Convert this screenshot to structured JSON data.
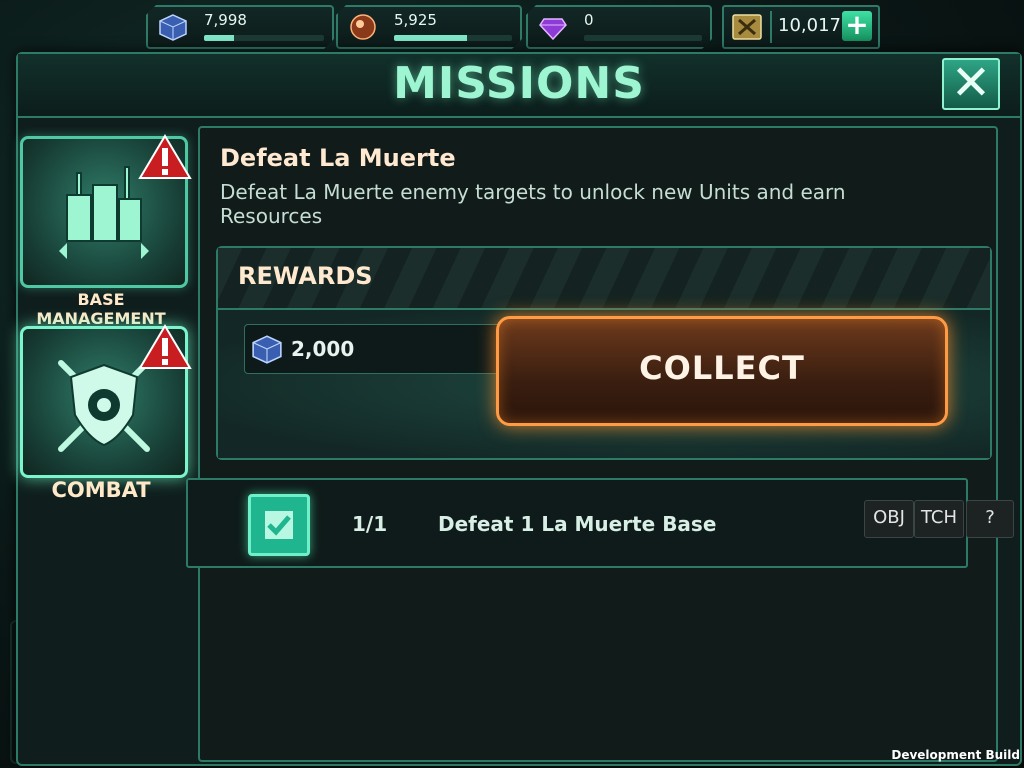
{
  "resources": {
    "cubes": {
      "icon": "cube-icon",
      "value": "7,998",
      "fill": 0.25
    },
    "ore": {
      "icon": "ore-icon",
      "value": "5,925",
      "fill": 0.62
    },
    "gems": {
      "icon": "gem-icon",
      "value": "0",
      "fill": 0.0
    },
    "gold": {
      "icon": "gold-icon",
      "value": "10,017"
    }
  },
  "header": {
    "title": "MISSIONS",
    "close_icon": "close-icon"
  },
  "sidebar": {
    "items": [
      {
        "label": "BASE MANAGEMENT",
        "icon": "base-icon",
        "alert": true,
        "active": false
      },
      {
        "label": "COMBAT",
        "icon": "combat-icon",
        "alert": true,
        "active": true
      }
    ]
  },
  "mission": {
    "title": "Defeat La Muerte",
    "description": "Defeat La Muerte enemy targets to unlock new Units and earn Resources",
    "rewards_label": "REWARDS",
    "reward": {
      "icon": "cube-icon",
      "value": "2,000"
    },
    "collect_label": "COLLECT"
  },
  "objectives": [
    {
      "progress": "1/1",
      "text": "Defeat 1 La Muerte Base",
      "completed": true
    }
  ],
  "debug_buttons": [
    "OBJ",
    "TCH",
    "?"
  ],
  "footer": {
    "build_label": "Development Build"
  },
  "colors": {
    "accent": "#2d7a67",
    "title": "#9ef5d2",
    "collect_border": "#ff9b45"
  }
}
